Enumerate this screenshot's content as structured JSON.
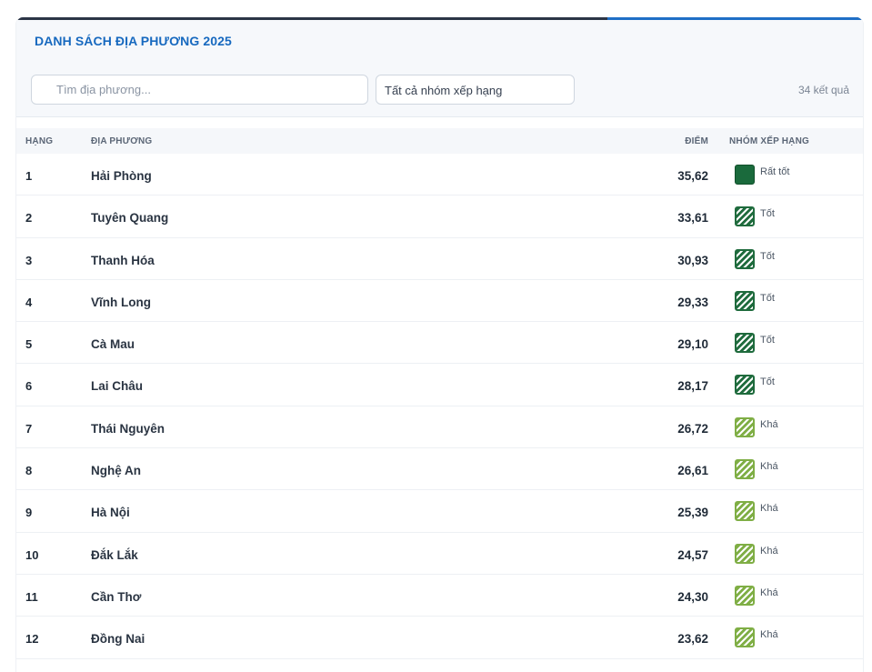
{
  "title": "DANH SÁCH ĐỊA PHƯƠNG 2025",
  "search": {
    "placeholder": "Tìm địa phương..."
  },
  "group_filter": {
    "selected": "Tất cả nhóm xếp hạng"
  },
  "result_count": "34 kết quả",
  "columns": {
    "rank": "HẠNG",
    "name": "ĐỊA PHƯƠNG",
    "score": "ĐIỂM",
    "group": "NHÓM XẾP HẠNG"
  },
  "colors": {
    "accent": "#1769bf",
    "very_good": "#1a6a3c",
    "good": "#1f6b3d",
    "fair": "#7fae45"
  },
  "rows": [
    {
      "rank": "1",
      "name": "Hải Phòng",
      "score": "35,62",
      "group": "Rất tốt",
      "badge": "solid"
    },
    {
      "rank": "2",
      "name": "Tuyên Quang",
      "score": "33,61",
      "group": "Tốt",
      "badge": "good"
    },
    {
      "rank": "3",
      "name": "Thanh Hóa",
      "score": "30,93",
      "group": "Tốt",
      "badge": "good"
    },
    {
      "rank": "4",
      "name": "Vĩnh Long",
      "score": "29,33",
      "group": "Tốt",
      "badge": "good"
    },
    {
      "rank": "5",
      "name": "Cà Mau",
      "score": "29,10",
      "group": "Tốt",
      "badge": "good"
    },
    {
      "rank": "6",
      "name": "Lai Châu",
      "score": "28,17",
      "group": "Tốt",
      "badge": "good"
    },
    {
      "rank": "7",
      "name": "Thái Nguyên",
      "score": "26,72",
      "group": "Khá",
      "badge": "fair"
    },
    {
      "rank": "8",
      "name": "Nghệ An",
      "score": "26,61",
      "group": "Khá",
      "badge": "fair"
    },
    {
      "rank": "9",
      "name": "Hà Nội",
      "score": "25,39",
      "group": "Khá",
      "badge": "fair"
    },
    {
      "rank": "10",
      "name": "Đắk Lắk",
      "score": "24,57",
      "group": "Khá",
      "badge": "fair"
    },
    {
      "rank": "11",
      "name": "Cần Thơ",
      "score": "24,30",
      "group": "Khá",
      "badge": "fair"
    },
    {
      "rank": "12",
      "name": "Đồng Nai",
      "score": "23,62",
      "group": "Khá",
      "badge": "fair"
    }
  ]
}
